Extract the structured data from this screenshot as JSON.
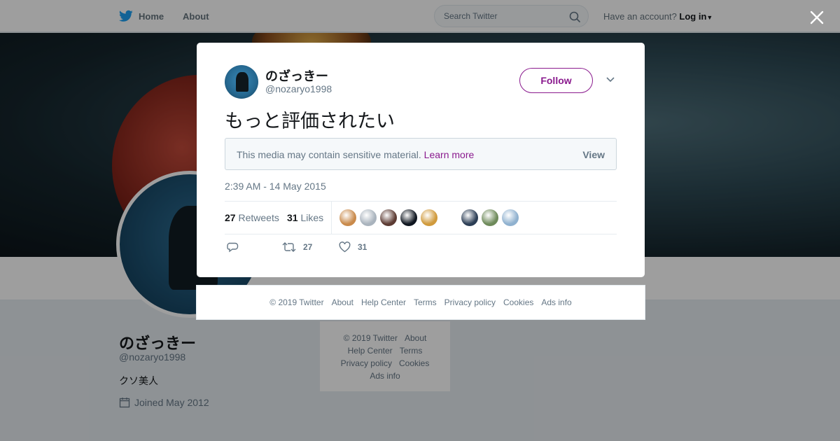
{
  "topbar": {
    "home_label": "Home",
    "about_label": "About",
    "search_placeholder": "Search Twitter",
    "account_prompt": "Have an account?",
    "login_label": "Log in"
  },
  "profile": {
    "name": "のざっきー",
    "handle": "@nozaryo1998",
    "bio": "クソ美人",
    "joined": "Joined May 2012"
  },
  "side_footer": {
    "line1": [
      "© 2019 Twitter",
      "About"
    ],
    "line2": [
      "Help Center",
      "Terms"
    ],
    "line3": [
      "Privacy policy",
      "Cookies"
    ],
    "line4": [
      "Ads info"
    ]
  },
  "tweet": {
    "author_name": "のざっきー",
    "author_handle": "@nozaryo1998",
    "follow_label": "Follow",
    "text": "もっと評価されたい",
    "sensitive_message": "This media may contain sensitive material.",
    "learn_more_label": "Learn more",
    "view_label": "View",
    "timestamp": "2:39 AM - 14 May 2015",
    "retweets_count": "27",
    "retweets_label": "Retweets",
    "likes_count": "31",
    "likes_label": "Likes",
    "likers": [
      {
        "color": "#c98a4b"
      },
      {
        "color": "#a9b3bd"
      },
      {
        "color": "#5c3b33"
      },
      {
        "color": "#0f1620"
      },
      {
        "color": "#d09a3c"
      },
      {
        "color": "#2c3e55"
      },
      {
        "color": "#6e8a5a"
      },
      {
        "color": "#8fb1cf"
      }
    ],
    "action_retweet_count": "27",
    "action_like_count": "31"
  },
  "footer": {
    "links": [
      "© 2019 Twitter",
      "About",
      "Help Center",
      "Terms",
      "Privacy policy",
      "Cookies",
      "Ads info"
    ]
  },
  "colors": {
    "accent": "#8a1a8e",
    "twitter_blue": "#1da1f2"
  }
}
